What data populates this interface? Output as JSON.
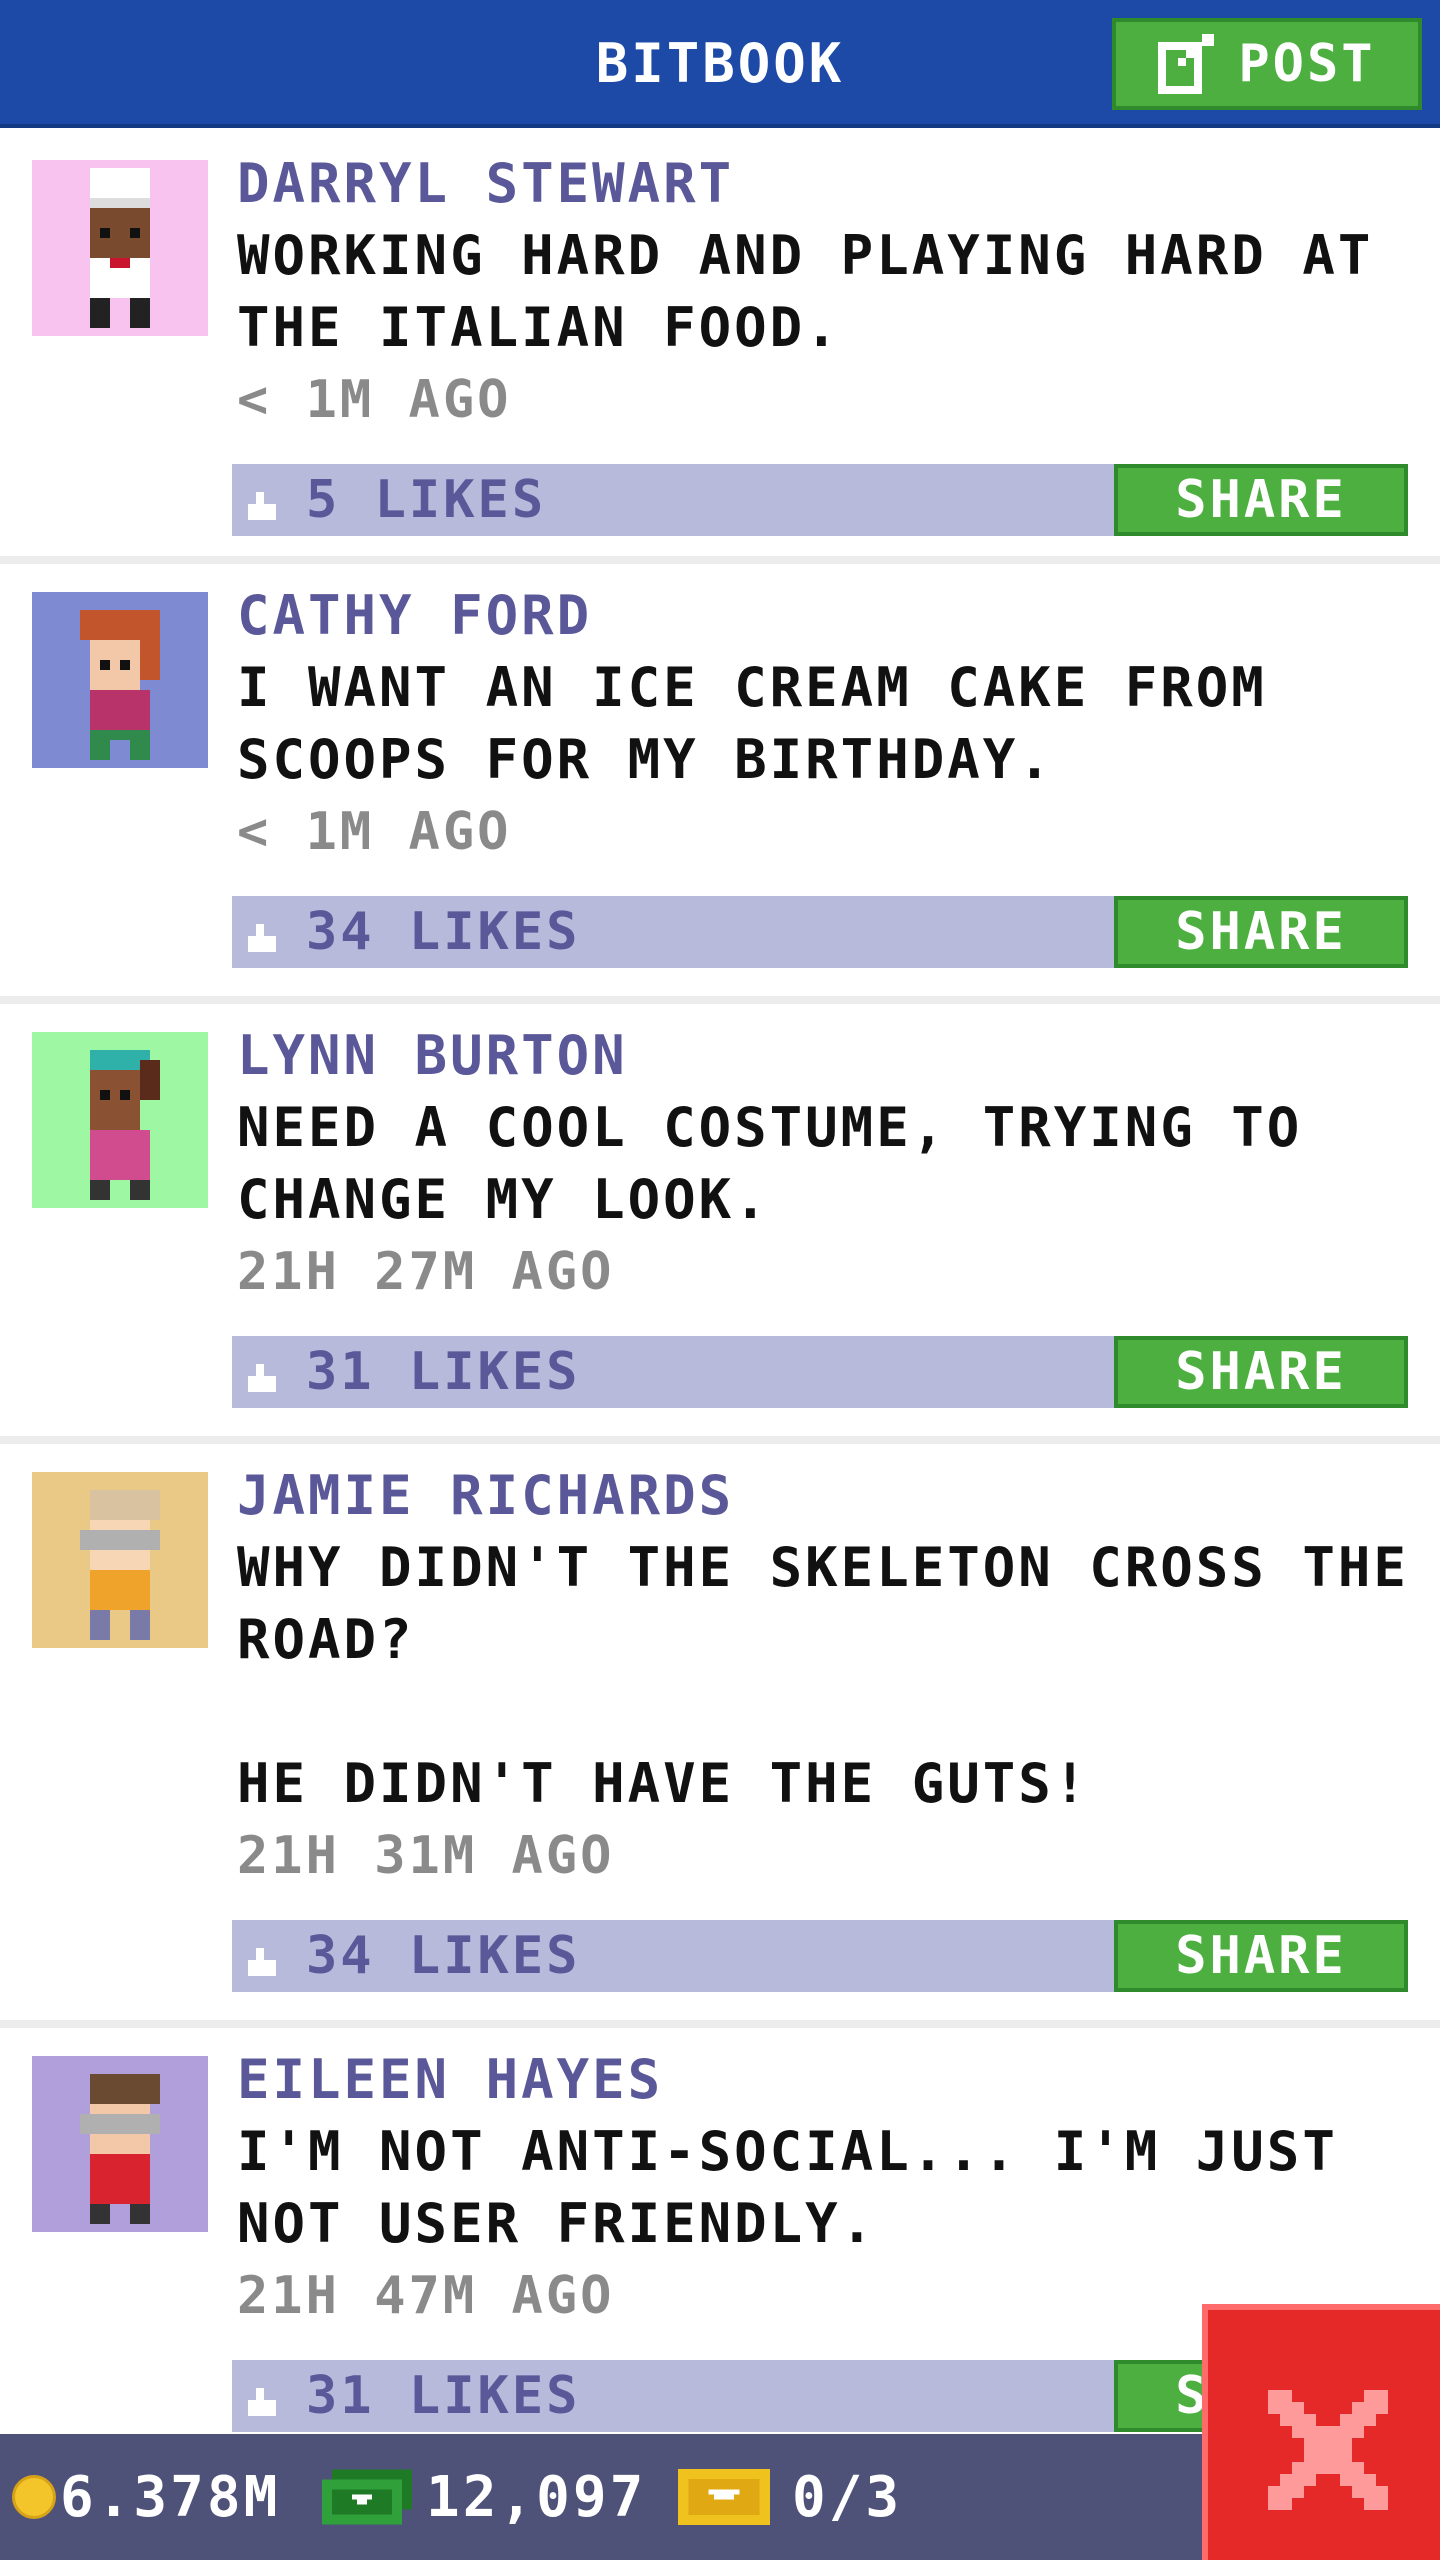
{
  "header": {
    "title": "BITBOOK",
    "post_label": "POST"
  },
  "posts": [
    {
      "author": "DARRYL STEWART",
      "message": "WORKING HARD AND PLAYING HARD AT THE ITALIAN FOOD.",
      "time": "< 1M AGO",
      "likes": "5 LIKES",
      "share": "SHARE",
      "avatar_bg": "#f9c3f0"
    },
    {
      "author": "CATHY FORD",
      "message": "I WANT AN ICE CREAM CAKE FROM SCOOPS FOR MY BIRTHDAY.",
      "time": "< 1M AGO",
      "likes": "34 LIKES",
      "share": "SHARE",
      "avatar_bg": "#7e8ad2"
    },
    {
      "author": "LYNN BURTON",
      "message": "NEED A COOL COSTUME, TRYING TO CHANGE MY LOOK.",
      "time": "21H 27M AGO",
      "likes": "31 LIKES",
      "share": "SHARE",
      "avatar_bg": "#9ef7a3"
    },
    {
      "author": "JAMIE RICHARDS",
      "message": "WHY DIDN'T THE SKELETON CROSS THE ROAD?\n\nHE DIDN'T HAVE THE GUTS!",
      "time": "21H 31M AGO",
      "likes": "34 LIKES",
      "share": "SHARE",
      "avatar_bg": "#e9c985"
    },
    {
      "author": "EILEEN HAYES",
      "message": "I'M NOT ANTI-SOCIAL... I'M JUST NOT USER FRIENDLY.",
      "time": "21H 47M AGO",
      "likes": "31 LIKES",
      "share": "SHARE",
      "avatar_bg": "#b09fdb"
    }
  ],
  "status": {
    "coins": "6.378M",
    "bux": "12,097",
    "tickets": "0/3"
  },
  "icons": {
    "post": "edit-icon",
    "like": "thumbs-up-icon",
    "coins": "coin-icon",
    "bux": "cash-icon",
    "tickets": "ticket-icon",
    "close": "close-icon"
  },
  "colors": {
    "header": "#1c4aa6",
    "accent_green": "#4caf3f",
    "like_bar": "#b8badb",
    "author_text": "#5a5898",
    "close_red": "#e52929"
  }
}
